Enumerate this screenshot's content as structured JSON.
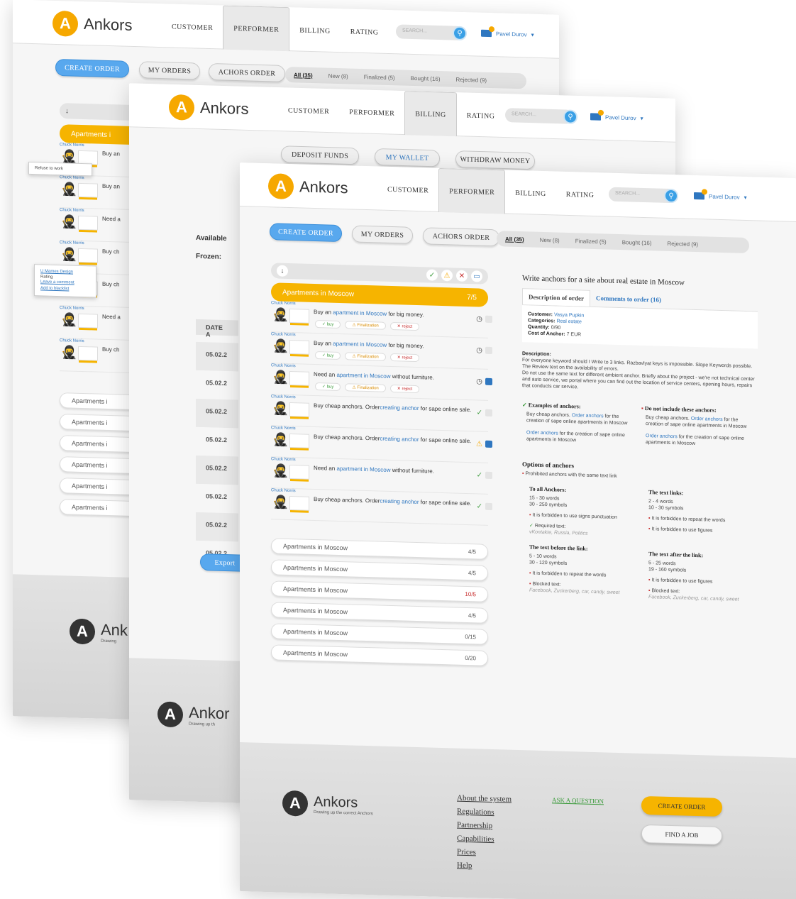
{
  "brand": {
    "name": "Ankors",
    "mark": "A",
    "tagline": "Drawing up the correct Anchors"
  },
  "nav": {
    "customer": "CUSTOMER",
    "performer": "PERFORMER",
    "billing": "BILLING",
    "rating": "RATING"
  },
  "search": {
    "placeholder": "SEARCH...",
    "icon": "search-icon"
  },
  "user": {
    "name": "Pavel Durov",
    "caret": "▾"
  },
  "subnav": {
    "create_order": "CREATE ORDER",
    "my_orders": "MY ORDERS",
    "anchors_order": "ACHORS ORDER"
  },
  "filters": {
    "all": "All (35)",
    "new": "New (8)",
    "finalized": "Finalized (5)",
    "bought": "Bought (16)",
    "rejected": "Rejected (9)"
  },
  "billing_subnav": {
    "deposit": "DEPOSIT FUNDS",
    "wallet": "MY WALLET",
    "withdraw": "WITHDRAW MONEY"
  },
  "billing_panel": {
    "available": "Available",
    "frozen": "Frozen:",
    "date_col": "DATE A",
    "dates": [
      "05.02.2",
      "05.02.2",
      "05.02.2",
      "05.02.2",
      "05.02.2",
      "05.02.2",
      "05.02.2",
      "05.02.2"
    ],
    "export": "Export"
  },
  "tools": {
    "sort": "↓",
    "ok": "✓",
    "warn": "⚠",
    "cancel": "✕"
  },
  "group": {
    "title": "Apartments in Moscow",
    "count": "7/5"
  },
  "back_group": {
    "title": "Apartments i"
  },
  "author": "Chuck Norris",
  "orders": [
    {
      "pre": "Buy an ",
      "link": "apartment in Moscow",
      "post": " for big money.",
      "line2": ""
    },
    {
      "pre": "Buy an ",
      "link": "apartment in Moscow",
      "post": " for big money.",
      "line2": ""
    },
    {
      "pre": "Need an ",
      "link": "apartment in Moscow",
      "post": " without furniture.",
      "line2": ""
    },
    {
      "pre": "Buy cheap anchors. Order",
      "link": "creating anchor",
      "post": " for sape online sale."
    },
    {
      "pre": "Buy cheap anchors. Order",
      "link": "creating anchor",
      "post": " for sape online sale."
    },
    {
      "pre": "Need an ",
      "link": "apartment in Moscow",
      "post": " without furniture."
    },
    {
      "pre": "Buy cheap anchors. Order",
      "link": "creating anchor",
      "post": " for sape online sale."
    }
  ],
  "back_orders": [
    "Buy an",
    "Buy an",
    "Need a",
    "Buy ch",
    "Buy ch",
    "Need a",
    "Buy ch"
  ],
  "back_order_link": "creatin",
  "actions": {
    "buy": "buy",
    "finalization": "Finalization",
    "reject": "reject"
  },
  "popup1": {
    "text": "Refuse to work"
  },
  "popup2": {
    "l1": "U Mames Design",
    "l2": "Rating",
    "l3": "Leave a comment",
    "l4": "Add to blacklist"
  },
  "categories": [
    {
      "name": "Apartments in Moscow",
      "count": "4/5"
    },
    {
      "name": "Apartments in Moscow",
      "count": "4/5"
    },
    {
      "name": "Apartments in Moscow",
      "count": "10/5"
    },
    {
      "name": "Apartments in Moscow",
      "count": "4/5"
    },
    {
      "name": "Apartments in Moscow",
      "count": "0/15"
    },
    {
      "name": "Apartments in Moscow",
      "count": "0/20"
    }
  ],
  "back_categories": [
    "Apartments i",
    "Apartments i",
    "Apartments i",
    "Apartments i",
    "Apartments i",
    "Apartments i"
  ],
  "detail": {
    "title": "Write anchors for a site about real estate in Moscow",
    "tab_desc": "Description of order",
    "tab_comments": "Comments to order (16)",
    "customer_label": "Customer:",
    "customer": "Vasya Pupkin",
    "categories_label": "Categories:",
    "categories": "Real estate",
    "quantity_label": "Quantity:",
    "quantity": "0/90",
    "cost_label": "Cost of Anchor:",
    "cost": "7 EUR",
    "desc_label": "Description:",
    "desc1": "For everyone keyword should I Write to 3 links. Razbavlyat keys is impossible. Slope Keywords possible. The Review text on the availability of errors.",
    "desc2": "Do not use the same text for different ambient anchor. Briefly about the project - we're not technical center and auto service, we portal where you can find out the location of service centers, opening hours, repairs that conducts car service.",
    "examples_title": "Examples of anchors:",
    "excluded_title": "Do not include these anchors:",
    "ex1_a": "Buy cheap anchors. ",
    "ex1_link": "Order anchors",
    "ex1_b": " for the creation of sape online apartments in Moscow",
    "ex2_link": "Order anchors",
    "ex2_b": " for the creation of sape online apartments in Moscow",
    "options_title": "Options of anchors",
    "prohibited": "Prohibited anchors with the same text link",
    "all_title": "To all Anchors:",
    "all_words": "15 - 30 words",
    "all_symbols": "30 - 250 symbols",
    "all_rule": "It is forbidden to use signs punctuation",
    "required_label": "Required text:",
    "required": "vKontakte, Russia, Politics",
    "links_title": "The text links:",
    "links_words": "2 - 4 words",
    "links_symbols": "10 - 30 symbols",
    "links_rule1": "It is forbidden to repeat the words",
    "links_rule2": "It is forbidden to use figures",
    "before_title": "The text before the link:",
    "before_words": "5 - 10 words",
    "before_symbols": "30 - 120 symbols",
    "before_rule": "It is forbidden to repeat the words",
    "blocked_label": "Blocked text:",
    "blocked": "Facebook, Zuckerberg, car, candy, sweet",
    "after_title": "The text after the link:",
    "after_words": "5 - 25 words",
    "after_symbols": "19 - 160 symbols",
    "after_rule": "It is forbidden to use figures"
  },
  "footer": {
    "links": [
      "About the system",
      "Regulations",
      "Partnership",
      "Capabilities",
      "Prices",
      "Help"
    ],
    "ask": "ASK A QUESTION",
    "create": "CREATE ORDER",
    "find": "FIND A JOB",
    "back_brand": "Ank",
    "mid_brand": "Ankor",
    "back_tag": "Drawing",
    "mid_tag": "Drawing up th"
  },
  "colors": {
    "accent": "#f6b400",
    "link": "#2f77c0",
    "primary_button": "#58a8ee",
    "ok": "#3a9a3a",
    "danger": "#c62828"
  }
}
